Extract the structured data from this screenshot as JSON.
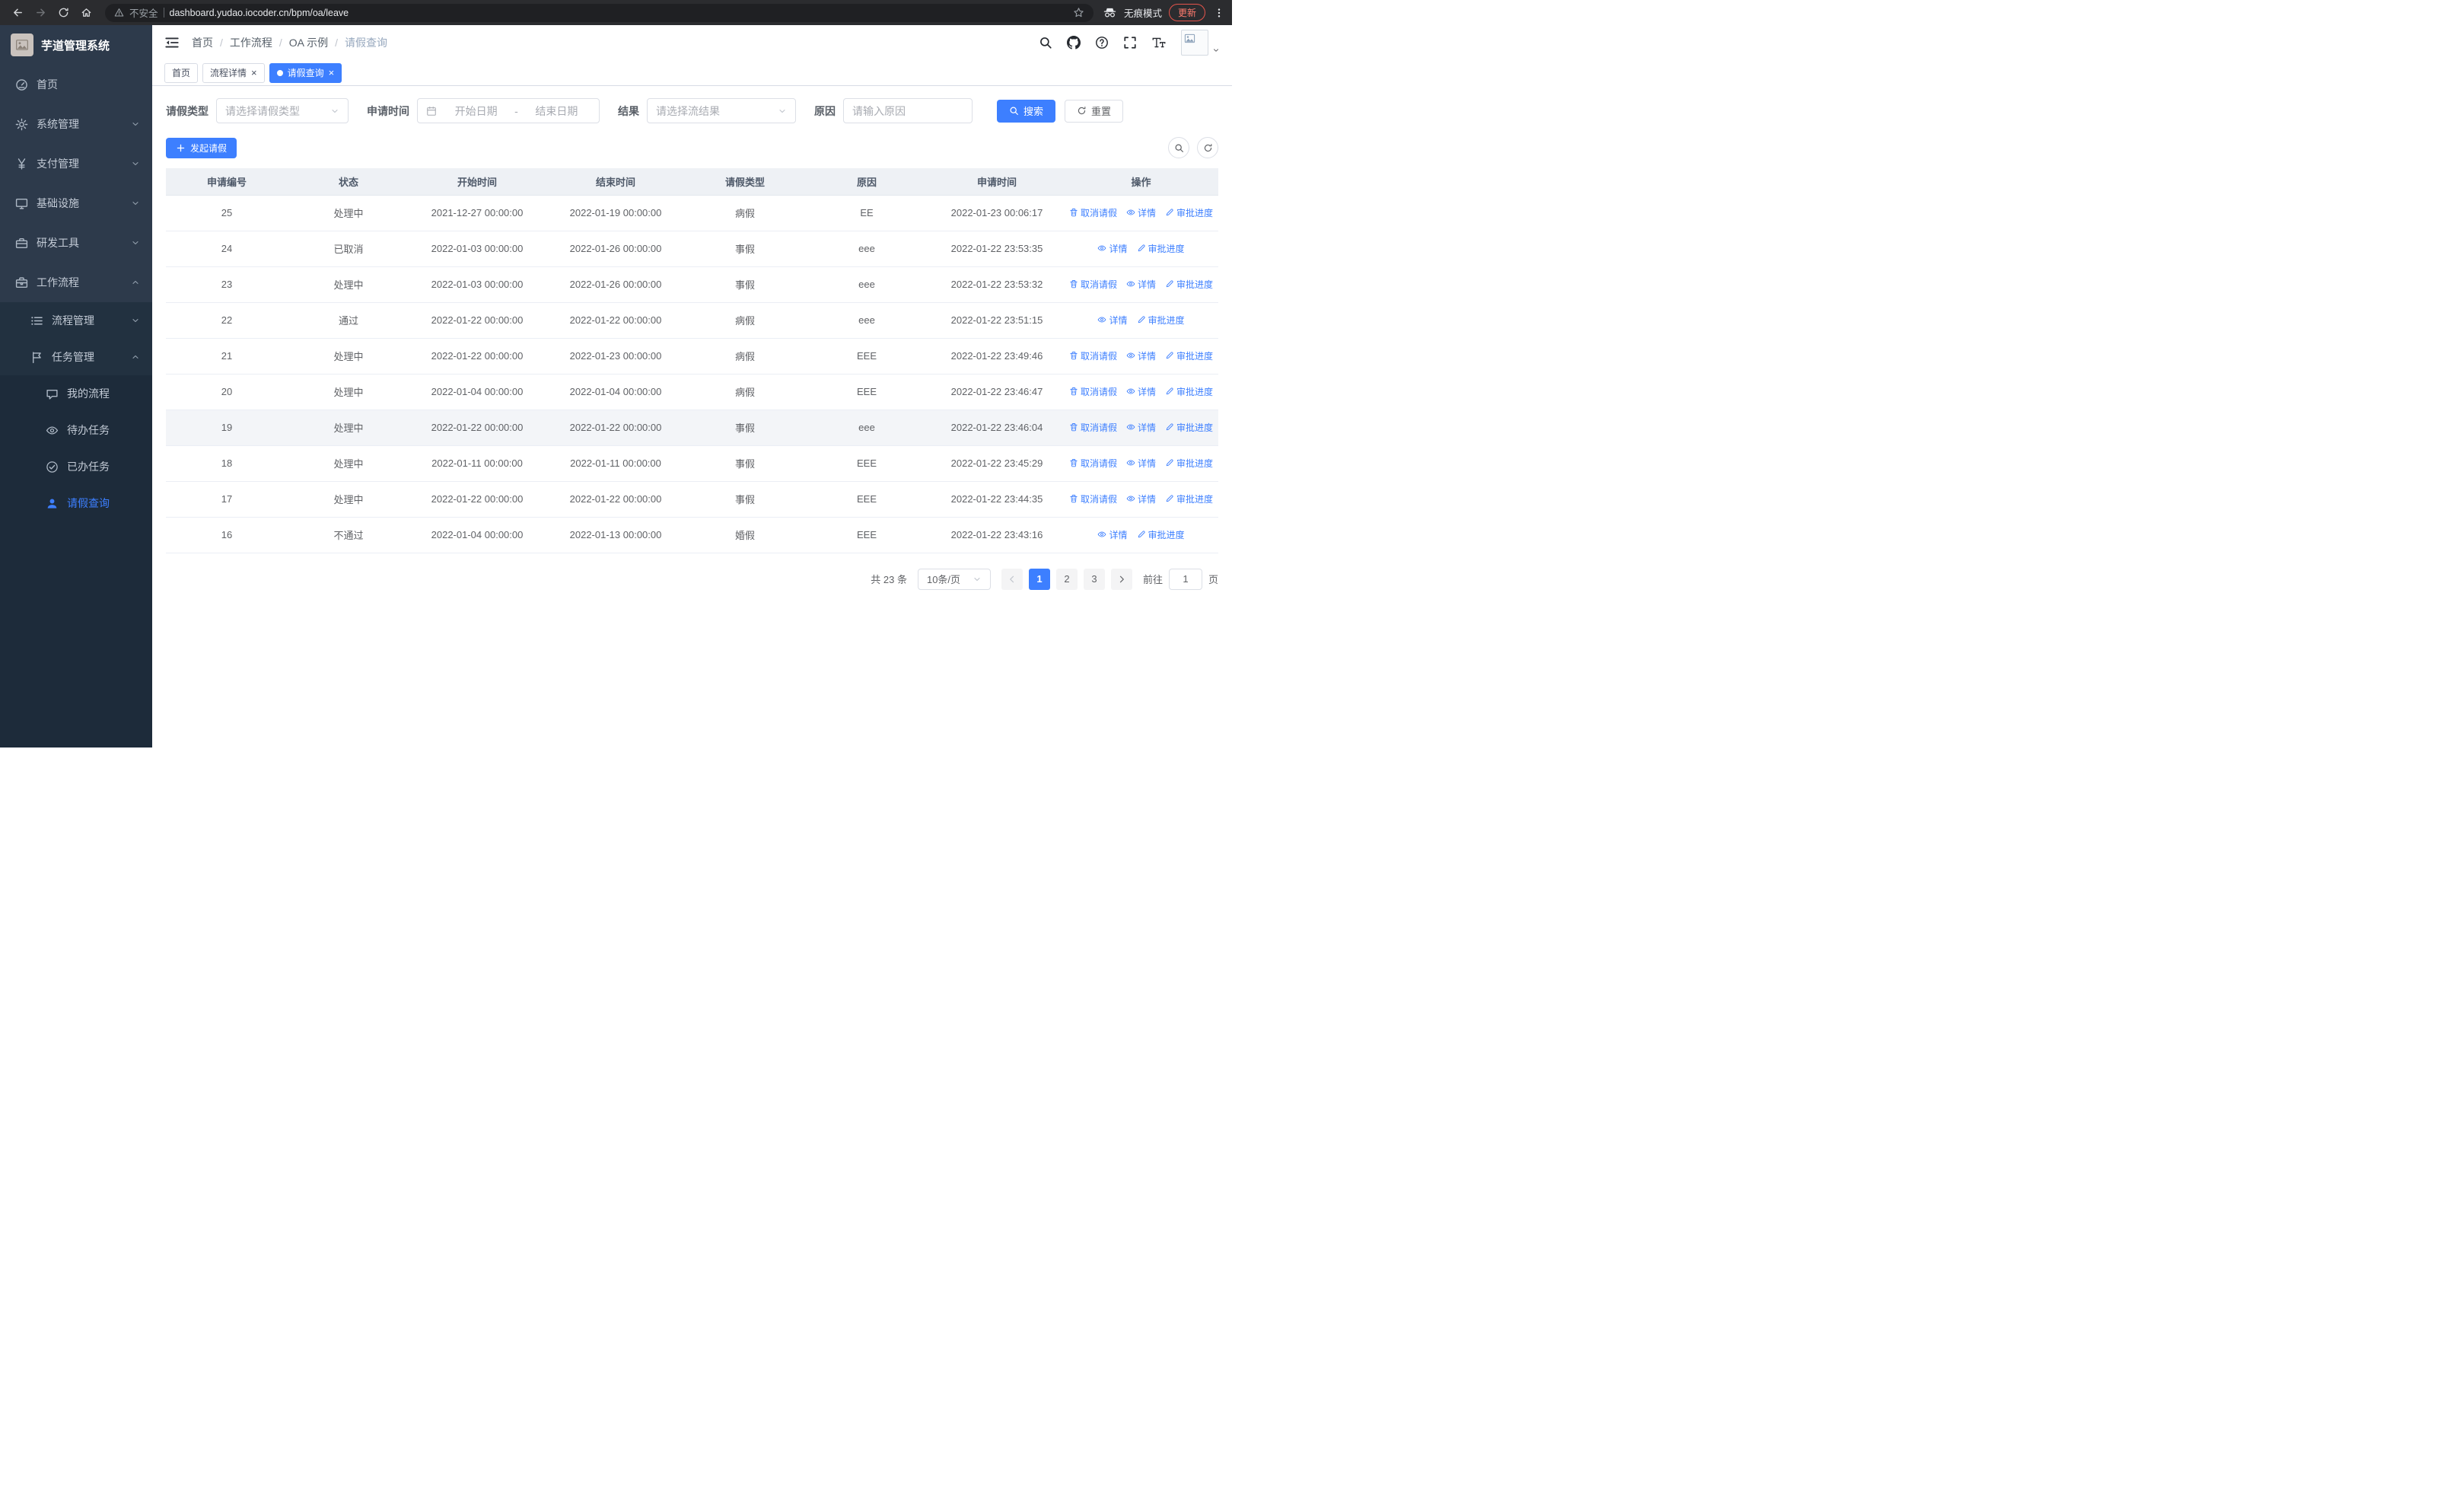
{
  "colors": {
    "primary": "#3d7fff",
    "sidebar_bg": "#2d3a4b",
    "table_header_bg": "#eef1f5",
    "active_tab_bg": "#3d7fff",
    "update_pill_red": "#e5544b"
  },
  "browser": {
    "security_label": "不安全",
    "url": "dashboard.yudao.iocoder.cn/bpm/oa/leave",
    "incognito_label": "无痕模式",
    "update_label": "更新"
  },
  "sidebar": {
    "logo_title": "芋道管理系统",
    "items": [
      {
        "id": "home",
        "label": "首页",
        "icon": "dashboard-icon",
        "level": 1
      },
      {
        "id": "system",
        "label": "系统管理",
        "icon": "gear-icon",
        "level": 1,
        "chevron": "down"
      },
      {
        "id": "payment",
        "label": "支付管理",
        "icon": "yen-icon",
        "level": 1,
        "chevron": "down"
      },
      {
        "id": "infrastructure",
        "label": "基础设施",
        "icon": "monitor-icon",
        "level": 1,
        "chevron": "down"
      },
      {
        "id": "dev-tools",
        "label": "研发工具",
        "icon": "toolbox-icon",
        "level": 1,
        "chevron": "down"
      },
      {
        "id": "workflow",
        "label": "工作流程",
        "icon": "briefcase-icon",
        "level": 1,
        "chevron": "up"
      },
      {
        "id": "process-management",
        "label": "流程管理",
        "icon": "list-icon",
        "level": 2,
        "chevron": "down"
      },
      {
        "id": "task-management",
        "label": "任务管理",
        "icon": "flag-icon",
        "level": 2,
        "chevron": "up"
      },
      {
        "id": "my-process",
        "label": "我的流程",
        "icon": "chat-icon",
        "level": 3
      },
      {
        "id": "todo-tasks",
        "label": "待办任务",
        "icon": "eye-icon",
        "level": 3
      },
      {
        "id": "done-tasks",
        "label": "已办任务",
        "icon": "check-circle-icon",
        "level": 3
      },
      {
        "id": "leave-query",
        "label": "请假查询",
        "icon": "user-icon",
        "level": 3,
        "active": true
      }
    ]
  },
  "breadcrumb": [
    "首页",
    "工作流程",
    "OA 示例",
    "请假查询"
  ],
  "tabs": [
    {
      "id": "home",
      "label": "首页",
      "closable": false,
      "active": false
    },
    {
      "id": "process-detail",
      "label": "流程详情",
      "closable": true,
      "active": false
    },
    {
      "id": "leave-query",
      "label": "请假查询",
      "closable": true,
      "active": true
    }
  ],
  "filters": {
    "leave_type": {
      "label": "请假类型",
      "placeholder": "请选择请假类型"
    },
    "apply_time": {
      "label": "申请时间",
      "start_placeholder": "开始日期",
      "separator": "-",
      "end_placeholder": "结束日期"
    },
    "result": {
      "label": "结果",
      "placeholder": "请选择流结果"
    },
    "reason": {
      "label": "原因",
      "placeholder": "请输入原因"
    },
    "search_label": "搜索",
    "reset_label": "重置"
  },
  "toolbar": {
    "create_label": "发起请假"
  },
  "table": {
    "columns": [
      "申请编号",
      "状态",
      "开始时间",
      "结束时间",
      "请假类型",
      "原因",
      "申请时间",
      "操作"
    ],
    "action_labels": {
      "cancel": "取消请假",
      "detail": "详情",
      "progress": "审批进度"
    },
    "rows": [
      {
        "id": "25",
        "status": "处理中",
        "start": "2021-12-27 00:00:00",
        "end": "2022-01-19 00:00:00",
        "type": "病假",
        "reason": "EE",
        "apply_time": "2022-01-23 00:06:17",
        "actions": [
          "cancel",
          "detail",
          "progress"
        ],
        "highlight": false
      },
      {
        "id": "24",
        "status": "已取消",
        "start": "2022-01-03 00:00:00",
        "end": "2022-01-26 00:00:00",
        "type": "事假",
        "reason": "eee",
        "apply_time": "2022-01-22 23:53:35",
        "actions": [
          "detail",
          "progress"
        ],
        "highlight": false
      },
      {
        "id": "23",
        "status": "处理中",
        "start": "2022-01-03 00:00:00",
        "end": "2022-01-26 00:00:00",
        "type": "事假",
        "reason": "eee",
        "apply_time": "2022-01-22 23:53:32",
        "actions": [
          "cancel",
          "detail",
          "progress"
        ],
        "highlight": false
      },
      {
        "id": "22",
        "status": "通过",
        "start": "2022-01-22 00:00:00",
        "end": "2022-01-22 00:00:00",
        "type": "病假",
        "reason": "eee",
        "apply_time": "2022-01-22 23:51:15",
        "actions": [
          "detail",
          "progress"
        ],
        "highlight": false
      },
      {
        "id": "21",
        "status": "处理中",
        "start": "2022-01-22 00:00:00",
        "end": "2022-01-23 00:00:00",
        "type": "病假",
        "reason": "EEE",
        "apply_time": "2022-01-22 23:49:46",
        "actions": [
          "cancel",
          "detail",
          "progress"
        ],
        "highlight": false
      },
      {
        "id": "20",
        "status": "处理中",
        "start": "2022-01-04 00:00:00",
        "end": "2022-01-04 00:00:00",
        "type": "病假",
        "reason": "EEE",
        "apply_time": "2022-01-22 23:46:47",
        "actions": [
          "cancel",
          "detail",
          "progress"
        ],
        "highlight": false
      },
      {
        "id": "19",
        "status": "处理中",
        "start": "2022-01-22 00:00:00",
        "end": "2022-01-22 00:00:00",
        "type": "事假",
        "reason": "eee",
        "apply_time": "2022-01-22 23:46:04",
        "actions": [
          "cancel",
          "detail",
          "progress"
        ],
        "highlight": true
      },
      {
        "id": "18",
        "status": "处理中",
        "start": "2022-01-11 00:00:00",
        "end": "2022-01-11 00:00:00",
        "type": "事假",
        "reason": "EEE",
        "apply_time": "2022-01-22 23:45:29",
        "actions": [
          "cancel",
          "detail",
          "progress"
        ],
        "highlight": false
      },
      {
        "id": "17",
        "status": "处理中",
        "start": "2022-01-22 00:00:00",
        "end": "2022-01-22 00:00:00",
        "type": "事假",
        "reason": "EEE",
        "apply_time": "2022-01-22 23:44:35",
        "actions": [
          "cancel",
          "detail",
          "progress"
        ],
        "highlight": false
      },
      {
        "id": "16",
        "status": "不通过",
        "start": "2022-01-04 00:00:00",
        "end": "2022-01-13 00:00:00",
        "type": "婚假",
        "reason": "EEE",
        "apply_time": "2022-01-22 23:43:16",
        "actions": [
          "detail",
          "progress"
        ],
        "highlight": false
      }
    ]
  },
  "pagination": {
    "total_label": "共 23 条",
    "page_size": "10条/页",
    "pages": [
      "1",
      "2",
      "3"
    ],
    "active_page": "1",
    "goto_label": "前往",
    "goto_value": "1",
    "page_suffix": "页"
  }
}
